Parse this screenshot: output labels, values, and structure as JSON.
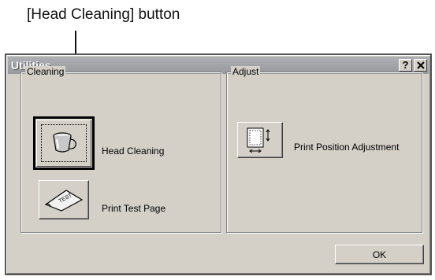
{
  "annotation": {
    "callout_text": "[Head Cleaning] button"
  },
  "window": {
    "title": "Utilities",
    "help_glyph": "?",
    "help_icon": "question-icon",
    "close_icon": "close-icon"
  },
  "cleaning": {
    "group_label": "Cleaning",
    "head_cleaning_label": "Head Cleaning",
    "head_cleaning_icon": "ink-cup-icon",
    "test_page_label": "Print Test Page",
    "test_page_icon": "test-paper-icon",
    "test_page_text": "TEST"
  },
  "adjust": {
    "group_label": "Adjust",
    "position_label": "Print Position Adjustment",
    "position_icon": "page-position-icon"
  },
  "footer": {
    "ok_label": "OK"
  }
}
